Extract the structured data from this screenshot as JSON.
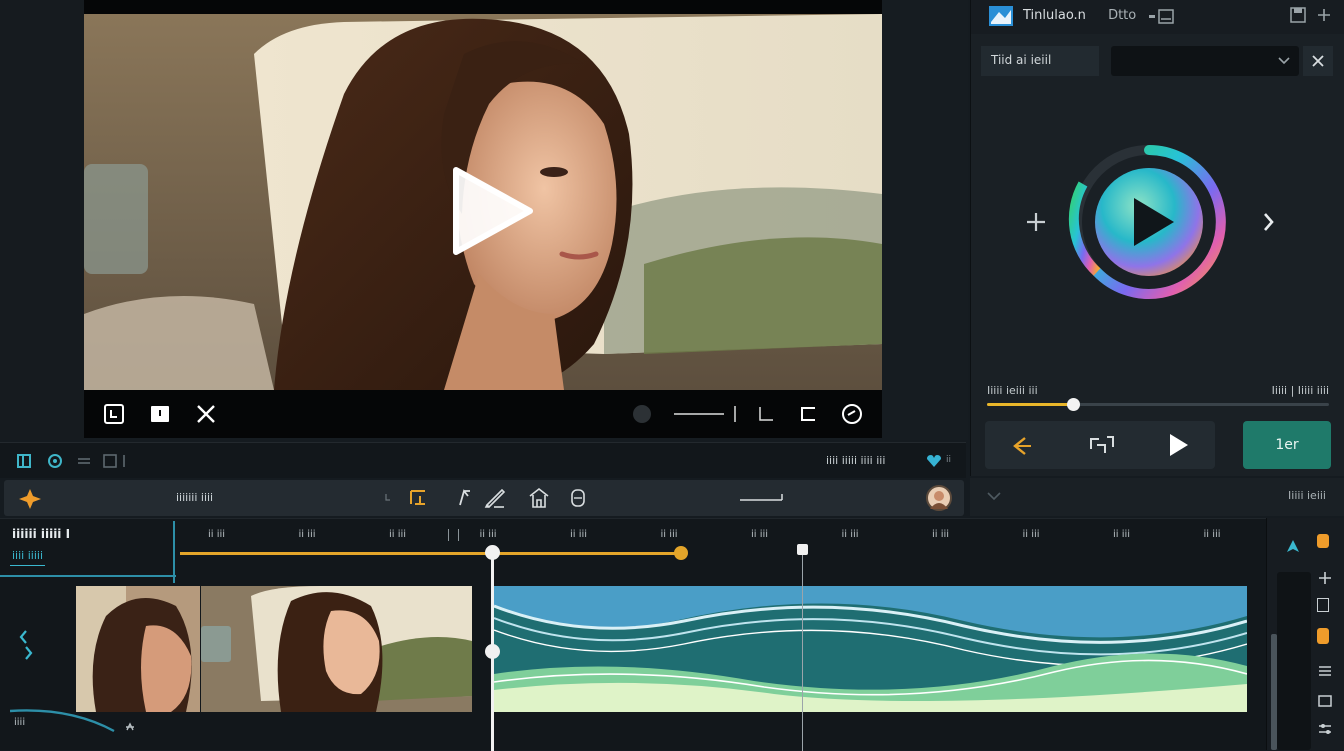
{
  "preview": {
    "play_icon": "play-triangle-icon",
    "controls": [
      "frame-icon",
      "lock-icon",
      "close-icon",
      "record-dot-icon",
      "line-icon",
      "corner-icon",
      "bracket-icon",
      "timer-icon"
    ]
  },
  "right_panel": {
    "title": "Tinlulao.n",
    "subtitle": "Dtto",
    "select_label": "Tiid ai ieiil",
    "select_value": "",
    "progress_left": "Iiiii ieiii iii",
    "progress_right": "Iiiii | Iiiii iiii",
    "progress_fraction": 0.25,
    "button_label": "1er",
    "footer_text": "Iiiii ieiii"
  },
  "status_bar": {
    "right_text": "iiii iiiii iiii iii",
    "right_suffix": "ii"
  },
  "tools_bar": {
    "left_label": "iiiiiii iiii"
  },
  "timeline": {
    "track_title": "iiiiii iiiii I",
    "track_subtitle": "iiii iiiii",
    "bottom_label": "iiii",
    "ticks": [
      "ii iii",
      "ii iii",
      "ii iii",
      "ii iii",
      "ii iii",
      "ii iii",
      "ii iii",
      "ii iii",
      "ii iii",
      "ii iii",
      "ii iii",
      "ii iii"
    ],
    "colors": {
      "accent": "#e3a52a",
      "wave_blue": "#4a9ec7",
      "wave_teal": "#1f6e72",
      "wave_green": "#7fcf9a"
    }
  }
}
